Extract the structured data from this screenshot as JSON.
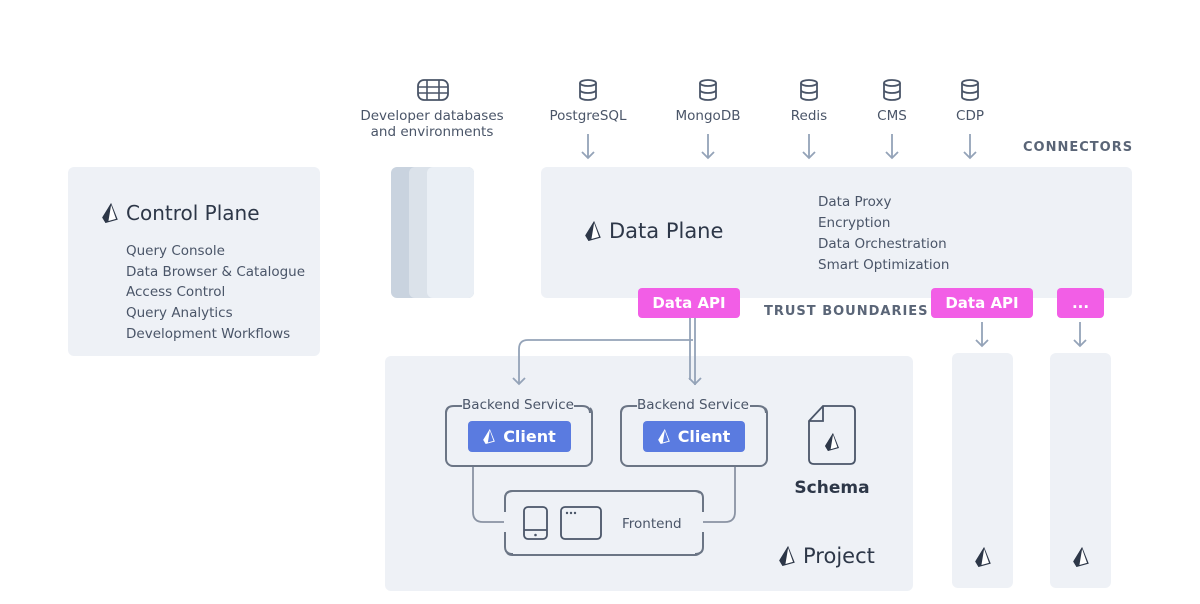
{
  "control_plane": {
    "title": "Control Plane",
    "items": [
      "Query Console",
      "Data Browser & Catalogue",
      "Access Control",
      "Query Analytics",
      "Development Workflows"
    ]
  },
  "developer_envs": {
    "label_line1": "Developer databases",
    "label_line2": "and environments",
    "icon": "database-stack-icon"
  },
  "connectors": {
    "heading": "CONNECTORS",
    "items": [
      "PostgreSQL",
      "MongoDB",
      "Redis",
      "CMS",
      "CDP"
    ],
    "icon": "database-icon"
  },
  "data_plane": {
    "title": "Data Plane",
    "features": [
      "Data Proxy",
      "Encryption",
      "Data Orchestration",
      "Smart Optimization"
    ]
  },
  "trust": {
    "label": "TRUST BOUNDARIES",
    "api_labels": [
      "Data API",
      "Data API",
      "..."
    ]
  },
  "project": {
    "title": "Project",
    "backend_label": "Backend Service",
    "client_label": "Client",
    "frontend_label": "Frontend",
    "schema_label": "Schema"
  },
  "colors": {
    "panel": "#eef1f6",
    "accent_pink": "#f25ee6",
    "client_blue": "#5a7be0",
    "arrow": "#94a3b8",
    "text": "#4a5568"
  }
}
